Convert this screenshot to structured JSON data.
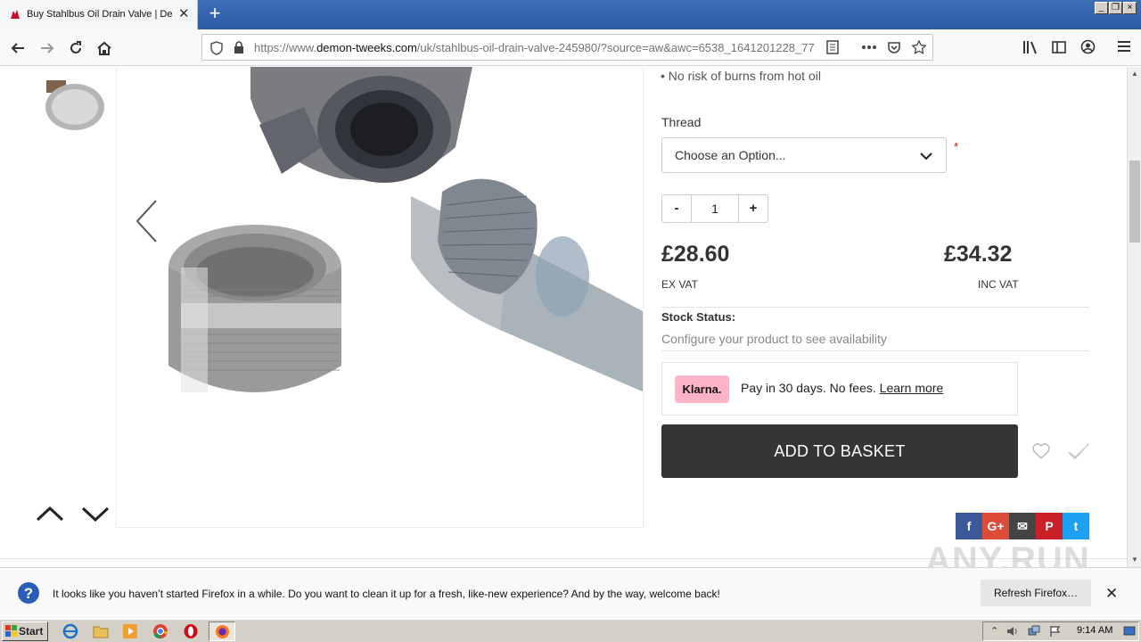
{
  "browser": {
    "tab_title": "Buy Stahlbus Oil Drain Valve | Demon Tweeks",
    "tab_close": "✕",
    "new_tab": "+",
    "url_prefix": "https://www.",
    "url_domain": "demon-tweeks.com",
    "url_rest": "/uk/stahlbus-oil-drain-valve-245980/?source=aw&awc=6538_1641201228_77"
  },
  "product": {
    "bullet_text": "No risk of burns from hot oil",
    "thread_label": "Thread",
    "thread_select_value": "Choose an Option...",
    "required_mark": "*",
    "qty_minus": "-",
    "qty_value": "1",
    "qty_plus": "+",
    "price_ex_vat": "£28.60",
    "ex_vat_label": "EX VAT",
    "price_inc_vat": "£34.32",
    "inc_vat_label": "INC VAT",
    "stock_status_label": "Stock Status:",
    "stock_status_text": "Configure your product to see availability",
    "klarna_badge": "Klarna.",
    "klarna_text": "Pay in 30 days. No fees.",
    "klarna_link": "Learn more",
    "add_to_basket": "ADD TO BASKET"
  },
  "social": {
    "facebook": "f",
    "google": "G+",
    "email": "✉",
    "pinterest": "P",
    "twitter": "t",
    "colors": {
      "facebook": "#3b5998",
      "google": "#dd4b39",
      "email": "#444444",
      "pinterest": "#cb2027",
      "twitter": "#1da1f2"
    }
  },
  "notification": {
    "message": "It looks like you haven’t started Firefox in a while. Do you want to clean it up for a fresh, like-new experience? And by the way, welcome back!",
    "refresh_button": "Refresh Firefox…",
    "close": "✕"
  },
  "watermark": "ANY.RUN",
  "taskbar": {
    "start_label": "Start",
    "clock": "9:14 AM"
  }
}
